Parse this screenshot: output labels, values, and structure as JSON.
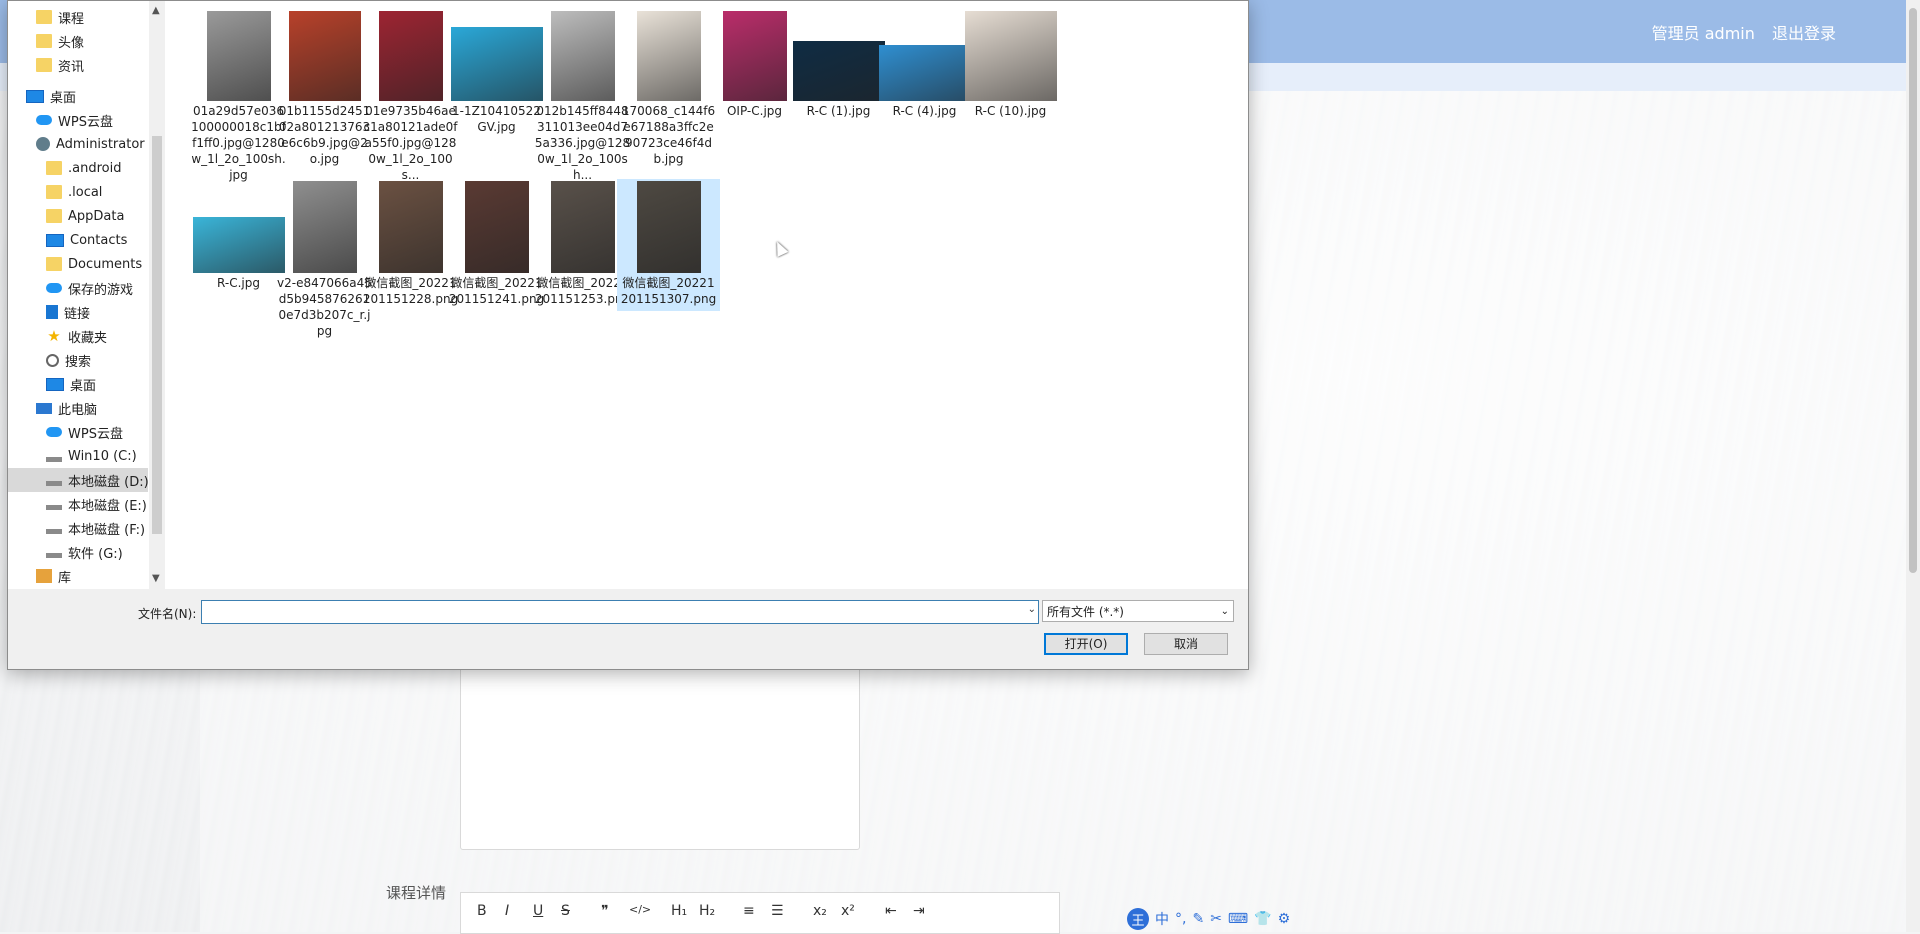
{
  "background_page": {
    "user_label": "管理员 admin",
    "logout_label": "退出登录",
    "field_label": "课程详情",
    "editor_toolbar": [
      "B",
      "I",
      "U",
      "S",
      "❞",
      "</>",
      "H₁",
      "H₂",
      "≡",
      "☰",
      "x₂",
      "x²",
      "⇤",
      "⇥"
    ]
  },
  "dialog": {
    "nav_items": [
      {
        "label": "课程",
        "icon": "folder-icon"
      },
      {
        "label": "头像",
        "icon": "folder-icon"
      },
      {
        "label": "资讯",
        "icon": "folder-icon"
      },
      {
        "label": "桌面",
        "icon": "desktop-icon"
      },
      {
        "label": "WPS云盘",
        "icon": "cloud-icon"
      },
      {
        "label": "Administrator",
        "icon": "user-icon"
      },
      {
        "label": ".android",
        "icon": "folder-icon"
      },
      {
        "label": ".local",
        "icon": "folder-icon"
      },
      {
        "label": "AppData",
        "icon": "folder-icon"
      },
      {
        "label": "Contacts",
        "icon": "contacts-icon"
      },
      {
        "label": "Documents",
        "icon": "folder-icon"
      },
      {
        "label": "保存的游戏",
        "icon": "games-icon"
      },
      {
        "label": "链接",
        "icon": "link-icon"
      },
      {
        "label": "收藏夹",
        "icon": "star-icon"
      },
      {
        "label": "搜索",
        "icon": "search-icon"
      },
      {
        "label": "桌面",
        "icon": "desktop-icon"
      },
      {
        "label": "此电脑",
        "icon": "pc-icon"
      },
      {
        "label": "WPS云盘",
        "icon": "cloud-icon"
      },
      {
        "label": "Win10 (C:)",
        "icon": "drive-icon"
      },
      {
        "label": "本地磁盘 (D:)",
        "icon": "drive-icon"
      },
      {
        "label": "本地磁盘 (E:)",
        "icon": "drive-icon"
      },
      {
        "label": "本地磁盘 (F:)",
        "icon": "drive-icon"
      },
      {
        "label": "软件 (G:)",
        "icon": "drive-icon"
      },
      {
        "label": "库",
        "icon": "library-icon"
      }
    ],
    "files": [
      {
        "name": "01a29d57e036100000018c1bff1ff0.jpg@1280w_1l_2o_100sh.jpg",
        "color": "#9a9a9a"
      },
      {
        "name": "01b1155d245102a801213763e6c6b9.jpg@2o.jpg",
        "color": "#b8412a"
      },
      {
        "name": "01e9735b46aec1a80121ade0fa55f0.jpg@1280w_1l_2o_100s...",
        "color": "#9d2432"
      },
      {
        "name": "1-1Z10410522GV.jpg",
        "color": "#2aa8d8"
      },
      {
        "name": "012b145ff8448311013ee04d75a336.jpg@1280w_1l_2o_100sh...",
        "color": "#bdbdbd"
      },
      {
        "name": "170068_c144f6e67188a3ffc2e90723ce46f4db.jpg",
        "color": "#e9e2d8"
      },
      {
        "name": "OIP-C.jpg",
        "color": "#ba2d6a"
      },
      {
        "name": "R-C (1).jpg",
        "color": "#0f2c44"
      },
      {
        "name": "R-C (4).jpg",
        "color": "#2f8fd1"
      },
      {
        "name": "R-C (10).jpg",
        "color": "#e6ddd3"
      },
      {
        "name": "R-C.jpg",
        "color": "#3ab5d9"
      },
      {
        "name": "v2-e847066a45d5b9458762610e7d3b207c_r.jpg",
        "color": "#8f8f8f"
      },
      {
        "name": "微信截图_20221201151228.png",
        "color": "#6b5142"
      },
      {
        "name": "微信截图_20221201151241.png",
        "color": "#5a3a33"
      },
      {
        "name": "微信截图_20221201151253.png",
        "color": "#59514a"
      },
      {
        "name": "微信截图_20221201151307.png",
        "color": "#4e4942"
      }
    ],
    "filename_label": "文件名(N):",
    "filename_value": "",
    "filetype_value": "所有文件 (*.*)",
    "open_label": "打开(O)",
    "cancel_label": "取消"
  }
}
